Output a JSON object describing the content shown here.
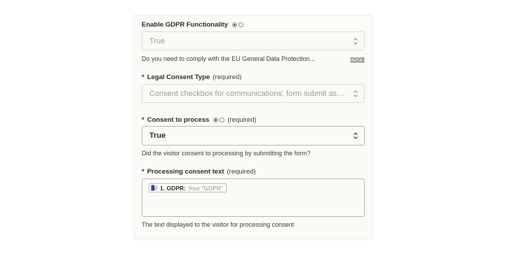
{
  "gdpr": {
    "label": "Enable GDPR Functionality",
    "value": "True",
    "help": "Do you need to comply with the EU General Data Protection...",
    "more": "more"
  },
  "legal_consent": {
    "star": "*",
    "label": "Legal Consent Type",
    "required": "(required)",
    "placeholder": "Consent checkbox for communications; form submit as c..."
  },
  "consent_process": {
    "star": "*",
    "label": "Consent to process",
    "required": "(required)",
    "value": "True",
    "help": "Did the visitor consent to processing by submitting the form?"
  },
  "processing_text": {
    "star": "*",
    "label": "Processing consent text",
    "required": "(required)",
    "pill_step": "1. GDPR:",
    "pill_name": "Your \"GDPR\"",
    "help": "The text displayed to the visitor for processing consent"
  },
  "icons": [
    "radio-toggle-icon",
    "chevron-updown-icon",
    "app-icon"
  ],
  "colors": {
    "card_bg": "#fbfaf6",
    "border": "#dddbd5",
    "border_strong": "#b9b6ae",
    "text": "#2b2a29",
    "muted": "#9b9994"
  }
}
